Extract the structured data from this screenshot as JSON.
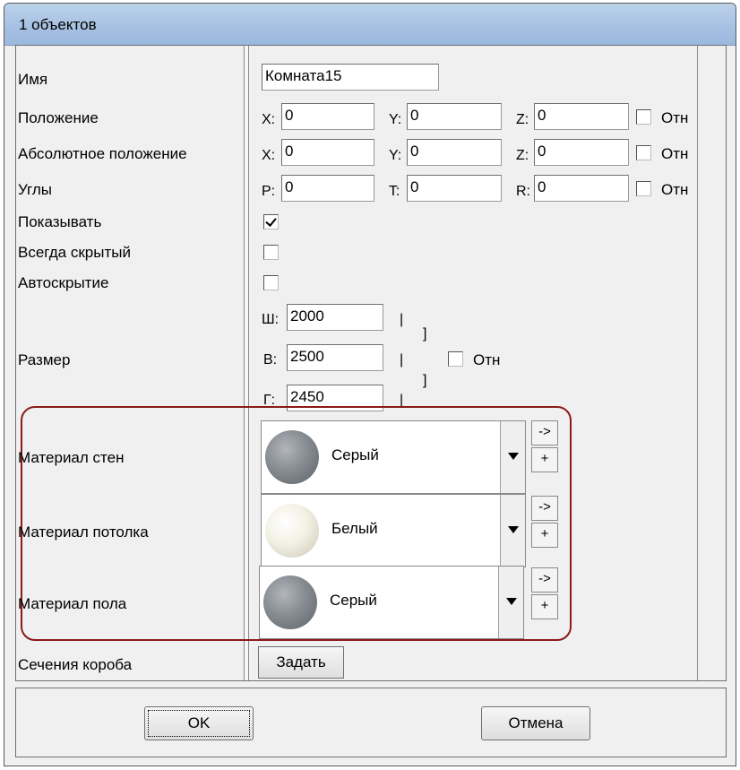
{
  "window": {
    "title": "1 объектов"
  },
  "rows": {
    "name": {
      "label": "Имя",
      "value": "Комната15"
    },
    "position": {
      "label": "Положение",
      "x_label": "X:",
      "x": "0",
      "y_label": "Y:",
      "y": "0",
      "z_label": "Z:",
      "z": "0",
      "rel_label": "Отн",
      "rel_checked": false
    },
    "abs_position": {
      "label": "Абсолютное положение",
      "x_label": "X:",
      "x": "0",
      "y_label": "Y:",
      "y": "0",
      "z_label": "Z:",
      "z": "0",
      "rel_label": "Отн",
      "rel_checked": false
    },
    "angles": {
      "label": "Углы",
      "p_label": "P:",
      "p": "0",
      "t_label": "T:",
      "t": "0",
      "r_label": "R:",
      "r": "0",
      "rel_label": "Отн",
      "rel_checked": false
    },
    "show": {
      "label": "Показывать",
      "checked": true
    },
    "always_hidden": {
      "label": "Всегда скрытый",
      "checked": false
    },
    "autohide": {
      "label": "Автоскрытие",
      "checked": false
    },
    "size": {
      "label": "Размер",
      "w_label": "Ш:",
      "w": "2000",
      "h_label": "В:",
      "h": "2500",
      "d_label": "Г:",
      "d": "2450",
      "sep": "|",
      "bracket": "]",
      "rel_label": "Отн",
      "rel_checked": false
    },
    "wall_material": {
      "label": "Материал стен",
      "value": "Серый",
      "color": "#878c92"
    },
    "ceiling_material": {
      "label": "Материал потолка",
      "value": "Белый",
      "color": "#f3f1e4"
    },
    "floor_material": {
      "label": "Материал пола",
      "value": "Серый",
      "color": "#878c92"
    },
    "box_sections": {
      "label": "Сечения короба",
      "button": "Задать"
    }
  },
  "material_buttons": {
    "apply": "->",
    "add": "+"
  },
  "footer": {
    "ok": "OK",
    "cancel": "Отмена"
  },
  "colors": {
    "highlight": "#8b1a1a",
    "titlebar": "#a5c0e2"
  }
}
